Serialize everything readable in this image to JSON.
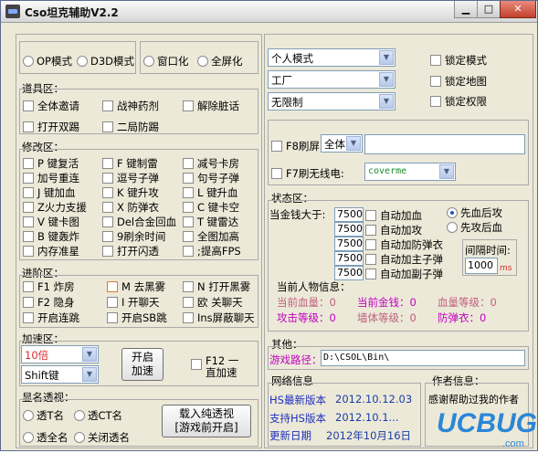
{
  "window": {
    "title": "Cso坦克辅助V2.2",
    "minimize": "▁",
    "maximize": "□",
    "close": "✕"
  },
  "mode_group": {
    "op": "OP模式",
    "d3d": "D3D模式",
    "windowed": "窗口化",
    "fullscreen": "全屏化"
  },
  "selects": {
    "mode": "个人模式",
    "map": "工厂",
    "limit": "无限制"
  },
  "locks": {
    "mode": "锁定模式",
    "map": "锁定地图",
    "perm": "锁定权限"
  },
  "prop": {
    "title": "道具区：",
    "items": [
      "全体邀请",
      "战神药剂",
      "解除脏话",
      "打开双踢",
      "二局防踢"
    ]
  },
  "modify": {
    "title": "修改区：",
    "items": [
      "P 键复活",
      "F 键制雷",
      "减号卡房",
      "加号重连",
      "逗号子弹",
      "句号子弹",
      "J 键加血",
      "K 键升攻",
      "L 键升血",
      "Z火力支援",
      "X 防弹衣",
      "C 键卡空",
      "V 键卡图",
      "Del合金回血",
      "T 键雷达",
      "B 键轰炸",
      "9刷余时间",
      "全图加高",
      "内存准星",
      "打开闪透",
      ";提高FPS"
    ]
  },
  "advanced": {
    "title": "进阶区：",
    "items": [
      "F1 炸房",
      "M 去黑雾",
      "N 打开黑雾",
      "F2  隐身",
      "I 开聊天",
      "欧 关聊天",
      "开启连跳",
      "开启SB跳",
      "Ins屏蔽聊天"
    ]
  },
  "speed": {
    "title": "加速区：",
    "value": "10倍",
    "key": "Shift键",
    "start_btn": "开启\n加速",
    "f12": "F12 一\n直加速"
  },
  "show": {
    "title": "显名透视：",
    "t_name": "透T名",
    "ct_name": "透CT名",
    "all_name": "透全名",
    "close": "关闭透名",
    "load_btn": "载入纯透视\n[游戏前开启]"
  },
  "f8": {
    "label": "F8刷屏",
    "select": "全体",
    "text": ""
  },
  "f7": {
    "label": "F7刷无线电:",
    "select": "coverme"
  },
  "status": {
    "title": "状态区：",
    "money_label": "当金钱大于:",
    "interval_label": "间隔时间:",
    "interval_value": "1000",
    "interval_unit": "ms",
    "rows": [
      {
        "value": "7500",
        "label": "自动加血"
      },
      {
        "value": "7500",
        "label": "自动加攻"
      },
      {
        "value": "7500",
        "label": "自动加防弹衣"
      },
      {
        "value": "7500",
        "label": "自动加主子弹"
      },
      {
        "value": "7500",
        "label": "自动加副子弹"
      }
    ],
    "radio1": "先血后攻",
    "radio2": "先攻后血"
  },
  "person": {
    "title": "当前人物信息：",
    "cur_hp": "当前血量：0",
    "cur_money": "当前金钱：0",
    "hp_level": "血量等级：0",
    "atk_level": "攻击等级：0",
    "wall_level": "墙体等级：0",
    "armor": "防弹衣：0"
  },
  "other": {
    "title": "其他：",
    "path_label": "游戏路径：",
    "path_value": "D:\\CSOL\\Bin\\"
  },
  "net": {
    "title": "网络信息",
    "latest": "HS最新版本",
    "latest_value": "2012.10.12.03",
    "support": "支持HS版本",
    "support_value": "2012.10.1...",
    "update": "更新日期",
    "update_value": "2012年10月16日"
  },
  "author": {
    "title": "作者信息：",
    "text": "感谢帮助过我的作者"
  },
  "watermark": {
    "text": "UCBUG游戏网",
    "sub": ".com"
  }
}
